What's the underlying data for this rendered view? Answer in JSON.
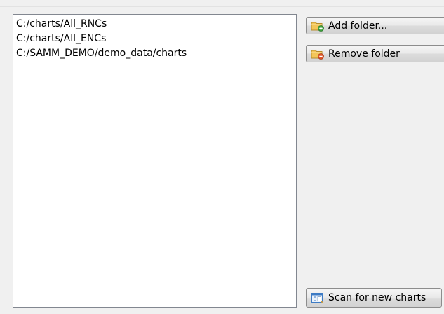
{
  "folders": [
    "C:/charts/All_RNCs",
    "C:/charts/All_ENCs",
    "C:/SAMM_DEMO/demo_data/charts"
  ],
  "buttons": {
    "add_folder": {
      "label": "Add folder...",
      "icon": "folder-add-icon"
    },
    "remove_folder": {
      "label": "Remove folder",
      "icon": "folder-remove-icon"
    },
    "scan": {
      "label": "Scan for new charts",
      "icon": "scan-icon"
    }
  },
  "colors": {
    "folder_yellow": "#f3c659",
    "add_green": "#3fa33f",
    "remove_red": "#e2572b",
    "scan_blue": "#3d7bc4"
  }
}
